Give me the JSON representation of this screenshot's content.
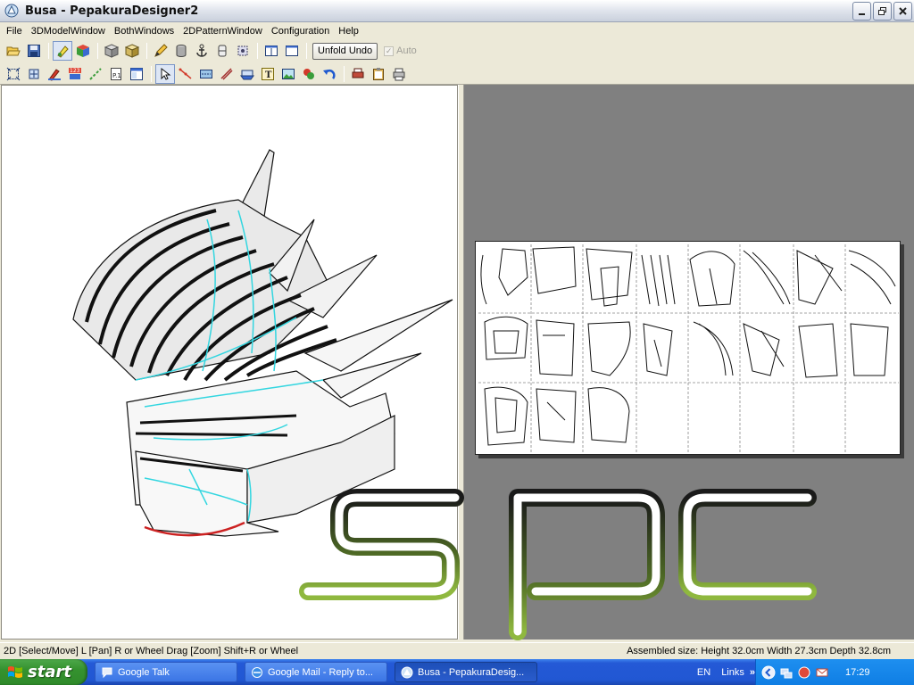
{
  "window": {
    "title": "Busa - PepakuraDesigner2"
  },
  "menu": [
    "File",
    "3DModelWindow",
    "BothWindows",
    "2DPatternWindow",
    "Configuration",
    "Help"
  ],
  "toolbar": {
    "row1_icons": [
      "open-icon",
      "save-icon",
      "texture-toggle-icon",
      "color-cube-icon",
      "solid-view-icon",
      "shaded-view-icon",
      "pencil-icon",
      "cylinder-icon",
      "anchor-icon",
      "edge-icon",
      "rotate-view-icon",
      "single-window-icon",
      "split-window-icon"
    ],
    "unfold_undo_label": "Unfold Undo",
    "auto_label": "Auto",
    "row2_icons": [
      "zoom-fit-icon",
      "move-part-icon",
      "edit-color-icon",
      "number-labels-icon",
      "join-edges-icon",
      "page-number-icon",
      "page-layout-icon",
      "select-arrow-icon",
      "edit-node-icon",
      "cut-line-icon",
      "fold-line-icon",
      "flap-icon",
      "text-icon",
      "image-icon",
      "puzzle-icon",
      "undo-icon",
      "print-color-icon",
      "clipboard-icon",
      "print-icon"
    ]
  },
  "status": {
    "left": "2D [Select/Move] L [Pan] R or Wheel Drag [Zoom] Shift+R or Wheel",
    "right": "Assembled size: Height 32.0cm Width 27.3cm Depth 32.8cm"
  },
  "watermark": {
    "text": "spc"
  },
  "taskbar": {
    "start_label": "start",
    "tasks": [
      {
        "label": "Google Talk",
        "active": false
      },
      {
        "label": "Google Mail - Reply to...",
        "active": false
      },
      {
        "label": "Busa - PepakuraDesig...",
        "active": true
      }
    ],
    "links_label": "Links",
    "language": "EN",
    "clock": "17:29"
  },
  "colors": {
    "accent_cyan": "#33d6e0",
    "cut_red": "#cc2222",
    "logo_green": "#7fa23a",
    "pane_gray": "#808080"
  }
}
